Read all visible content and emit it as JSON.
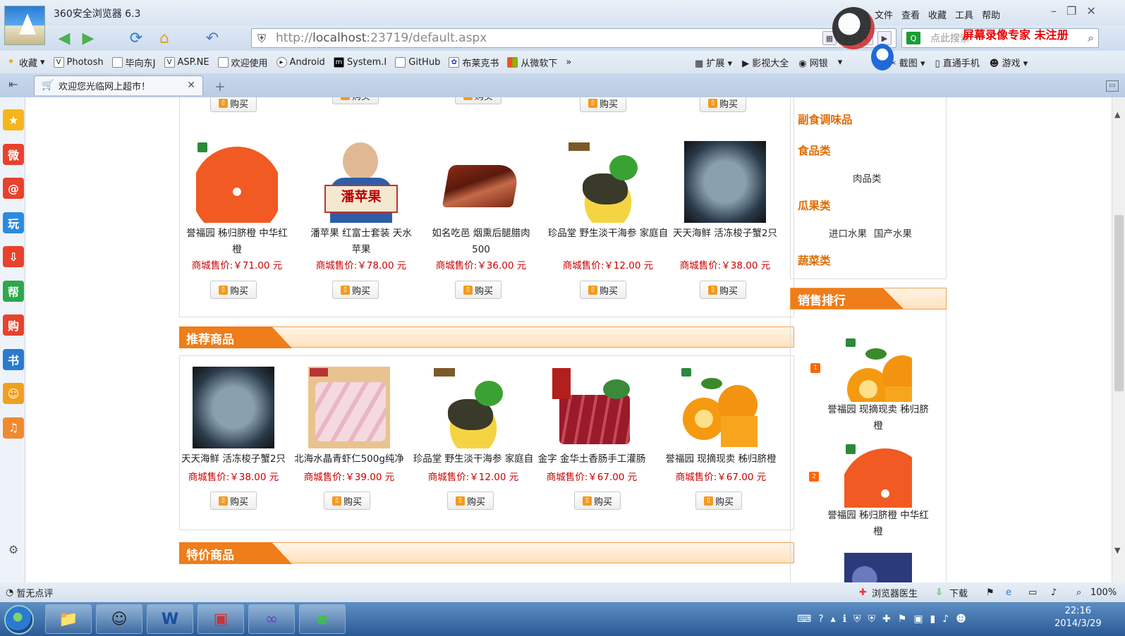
{
  "browser": {
    "title": "360安全浏览器 6.3",
    "menu": [
      "文件",
      "查看",
      "收藏",
      "工具",
      "帮助"
    ],
    "watermark": "屏幕录像专家  未注册",
    "address": {
      "prefix": "http://",
      "host": "localhost",
      "rest": ":23719/default.aspx"
    },
    "search_placeholder": "点此搜索",
    "bookmarks": [
      "收藏",
      "Photosh",
      "毕向东J",
      "ASP.NE",
      "欢迎使用",
      "Android",
      "System.I",
      "GitHub",
      "布莱克书",
      "从微软下"
    ],
    "bookmarks_more": "»",
    "toolbar_right": [
      "扩展",
      "影视大全",
      "网银",
      "",
      "截图",
      "直通手机",
      "游戏"
    ],
    "tab_title": "欢迎您光临网上超市！",
    "status_left": "暂无点评",
    "status_right": [
      "浏览器医生",
      "下载",
      "100%"
    ]
  },
  "taskbar": {
    "time": "22:16",
    "date": "2014/3/29"
  },
  "sidebar_icons": [
    "star-icon",
    "weibo-icon",
    "mail-icon",
    "play-icon",
    "download-icon",
    "help-icon",
    "shop-icon",
    "book-icon",
    "smile-icon",
    "music-icon",
    "settings-icon"
  ],
  "sidebar_glyphs": [
    "★",
    "微",
    "@",
    "玩",
    "⇩",
    "帮",
    "购",
    "书",
    "☺",
    "♫",
    "⚙"
  ],
  "buy_label": "购买",
  "price_prefix": "商城售价:",
  "row1": [
    {
      "name": "誉福园 秭归脐橙 中华红橙",
      "price": "￥71.00 元",
      "img": "orange"
    },
    {
      "name": "潘苹果 红富士套装 天水苹果",
      "price": "￥78.00 元",
      "img": "apple"
    },
    {
      "name": "如名吃邑 烟熏后腿腊肉500",
      "price": "￥36.00 元",
      "img": "ham"
    },
    {
      "name": "珍品堂 野生淡干海参 家庭自",
      "price": "￥12.00 元",
      "img": "seacucumber"
    },
    {
      "name": "天天海鲜 活冻梭子蟹2只",
      "price": "￥38.00 元",
      "img": "crab"
    }
  ],
  "apple_label": "潘苹果",
  "recommend_title": "推荐商品",
  "recommend": [
    {
      "name": "天天海鲜 活冻梭子蟹2只",
      "price": "￥38.00 元",
      "img": "crab"
    },
    {
      "name": "北海水晶青虾仁500g纯净",
      "price": "￥39.00 元",
      "img": "shrimp"
    },
    {
      "name": "珍品堂 野生淡干海参 家庭自",
      "price": "￥12.00 元",
      "img": "seacucumber"
    },
    {
      "name": "金字 金华土香肠手工灌肠",
      "price": "￥67.00 元",
      "img": "sausage"
    },
    {
      "name": "誉福园 现摘现卖 秭归脐橙",
      "price": "￥67.00 元",
      "img": "oranges"
    }
  ],
  "special_title": "特价商品",
  "categories": [
    {
      "title": "副食调味品",
      "subs": []
    },
    {
      "title": "食品类",
      "subs": [
        "肉品类"
      ]
    },
    {
      "title": "瓜果类",
      "subs": [
        "进口水果",
        "国产水果"
      ]
    },
    {
      "title": "蔬菜类",
      "subs": []
    }
  ],
  "ranking_title": "销售排行",
  "ranking": [
    {
      "name": "誉福园 现摘现卖 秭归脐橙",
      "img": "oranges"
    },
    {
      "name": "誉福园 秭归脐橙 中华红橙",
      "img": "orange"
    },
    {
      "name": "",
      "img": "blueberry"
    }
  ],
  "colors": {
    "accent": "#ee7d1a",
    "price": "#cc0000",
    "category": "#e06c00"
  }
}
